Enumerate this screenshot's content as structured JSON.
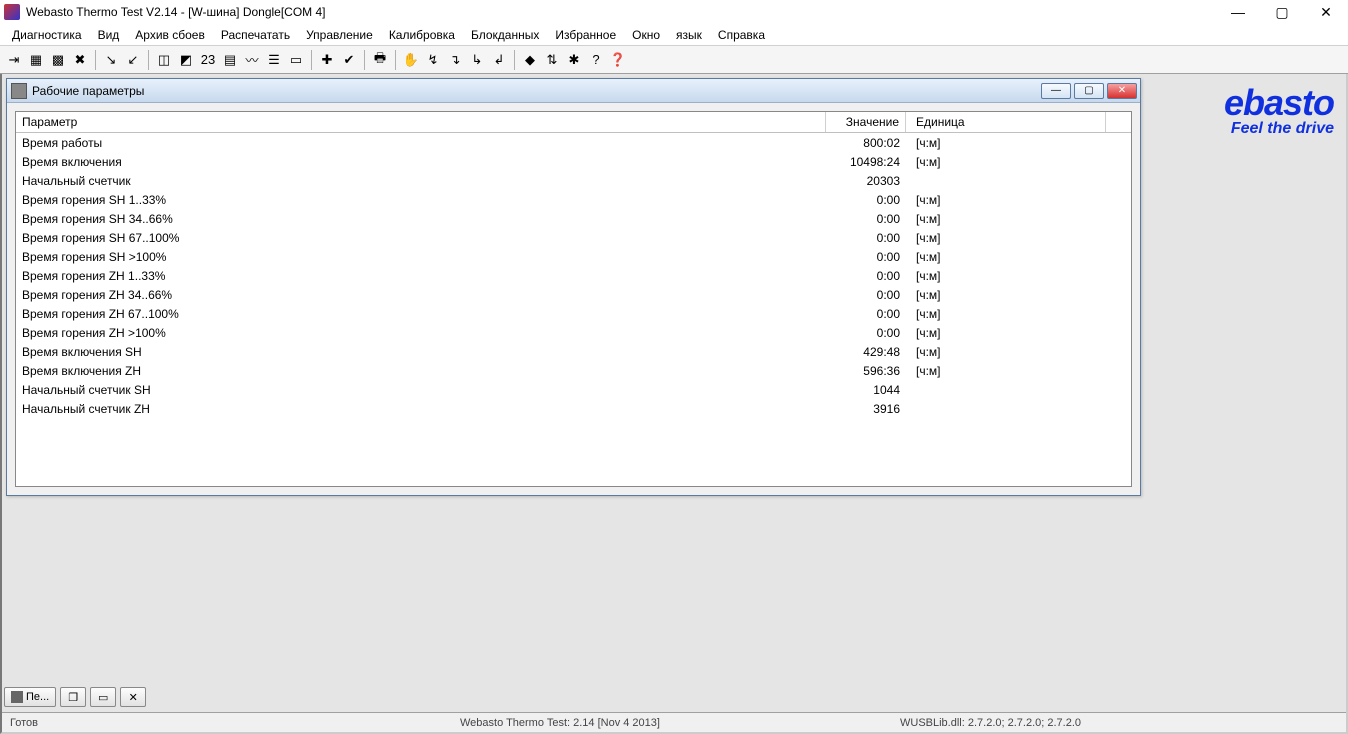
{
  "title": "Webasto Thermo Test V2.14 - [W-шина] Dongle[COM 4]",
  "menu": [
    "Диагностика",
    "Вид",
    "Архив сбоев",
    "Распечатать",
    "Управление",
    "Калибровка",
    "Блокданных",
    "Избранное",
    "Окно",
    "язык",
    "Справка"
  ],
  "logo": {
    "main": "ebasto",
    "sub": "Feel the drive"
  },
  "child": {
    "title": "Рабочие параметры",
    "headers": {
      "param": "Параметр",
      "value": "Значение",
      "unit": "Единица"
    },
    "rows": [
      {
        "param": "Время работы",
        "value": "800:02",
        "unit": "[ч:м]"
      },
      {
        "param": "Время включения",
        "value": "10498:24",
        "unit": "[ч:м]"
      },
      {
        "param": "Начальный счетчик",
        "value": "20303",
        "unit": ""
      },
      {
        "param": "Время горения SH 1..33%",
        "value": "0:00",
        "unit": "[ч:м]"
      },
      {
        "param": "Время горения SH 34..66%",
        "value": "0:00",
        "unit": "[ч:м]"
      },
      {
        "param": "Время горения SH 67..100%",
        "value": "0:00",
        "unit": "[ч:м]"
      },
      {
        "param": "Время горения SH >100%",
        "value": "0:00",
        "unit": "[ч:м]"
      },
      {
        "param": "Время горения ZH 1..33%",
        "value": "0:00",
        "unit": "[ч:м]"
      },
      {
        "param": "Время горения ZH 34..66%",
        "value": "0:00",
        "unit": "[ч:м]"
      },
      {
        "param": "Время горения ZH 67..100%",
        "value": "0:00",
        "unit": "[ч:м]"
      },
      {
        "param": "Время горения ZH >100%",
        "value": "0:00",
        "unit": "[ч:м]"
      },
      {
        "param": "Время включения SH",
        "value": "429:48",
        "unit": "[ч:м]"
      },
      {
        "param": "Время включения ZH",
        "value": "596:36",
        "unit": "[ч:м]"
      },
      {
        "param": "Начальный счетчик SH",
        "value": "1044",
        "unit": ""
      },
      {
        "param": "Начальный счетчик ZH",
        "value": "3916",
        "unit": ""
      }
    ]
  },
  "taskbar": {
    "item": "Пе..."
  },
  "status": {
    "s1": "Готов",
    "s2": "Webasto Thermo Test: 2.14 [Nov  4 2013]",
    "s3": "WUSBLib.dll: 2.7.2.0; 2.7.2.0; 2.7.2.0"
  },
  "toolbar_icons": [
    {
      "name": "connect-icon",
      "g": "⇥"
    },
    {
      "name": "grid1-icon",
      "g": "▦"
    },
    {
      "name": "grid2-icon",
      "g": "▩"
    },
    {
      "name": "cancel-icon",
      "g": "✖"
    },
    {
      "sep": true
    },
    {
      "name": "out-icon",
      "g": "↘"
    },
    {
      "name": "in-icon",
      "g": "↙"
    },
    {
      "sep": true
    },
    {
      "name": "chart1-icon",
      "g": "◫"
    },
    {
      "name": "chart2-icon",
      "g": "◩"
    },
    {
      "name": "num-icon",
      "g": "23"
    },
    {
      "name": "bars-icon",
      "g": "▤"
    },
    {
      "name": "wave-icon",
      "g": "〰"
    },
    {
      "name": "list-icon",
      "g": "☰"
    },
    {
      "name": "page-icon",
      "g": "▭"
    },
    {
      "sep": true
    },
    {
      "name": "plus-icon",
      "g": "✚"
    },
    {
      "name": "check-icon",
      "g": "✔"
    },
    {
      "sep": true
    },
    {
      "name": "print-icon",
      "g": "🖶"
    },
    {
      "sep": true
    },
    {
      "name": "hand-icon",
      "g": "✋"
    },
    {
      "name": "arrow1-icon",
      "g": "↯"
    },
    {
      "name": "arrow2-icon",
      "g": "↴"
    },
    {
      "name": "arrow3-icon",
      "g": "↳"
    },
    {
      "name": "arrow4-icon",
      "g": "↲"
    },
    {
      "sep": true
    },
    {
      "name": "plug-icon",
      "g": "◆"
    },
    {
      "name": "txrx-icon",
      "g": "⇅"
    },
    {
      "name": "bug-icon",
      "g": "✱"
    },
    {
      "name": "help-icon",
      "g": "?"
    },
    {
      "name": "whatsthis-icon",
      "g": "❓"
    }
  ]
}
